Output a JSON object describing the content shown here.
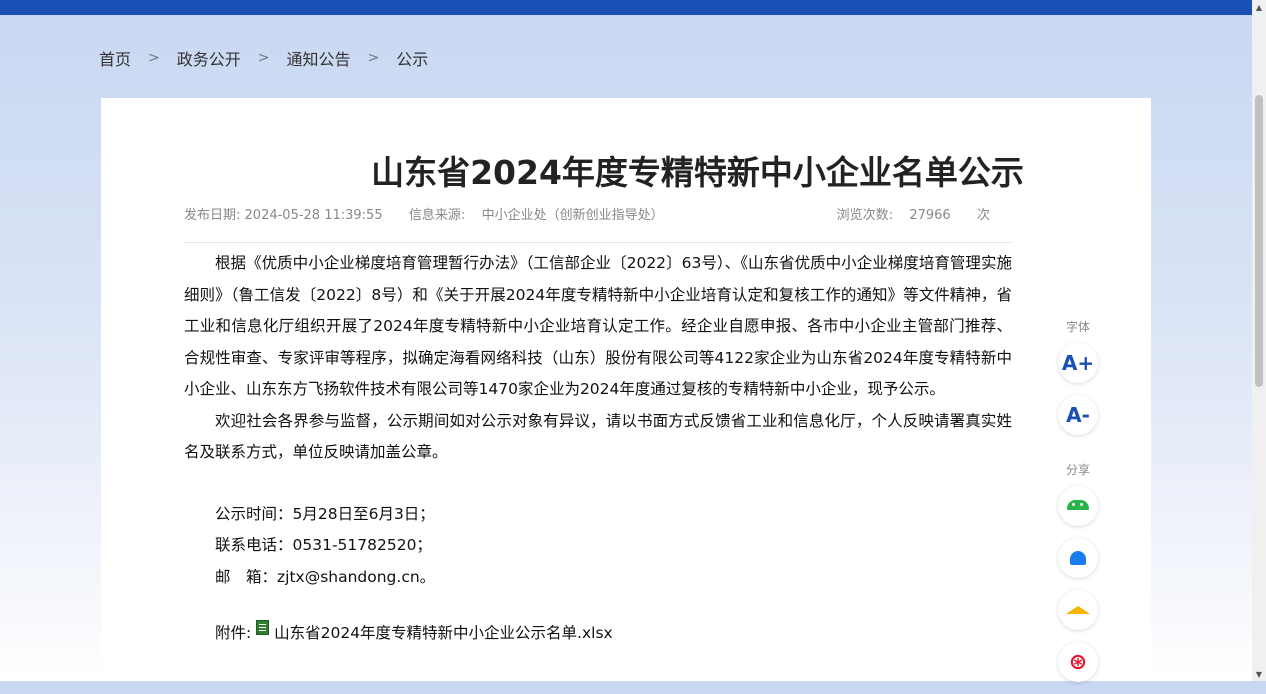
{
  "breadcrumb": {
    "items": [
      "首页",
      "政务公开",
      "通知公告",
      "公示"
    ],
    "separator": ">"
  },
  "article": {
    "title": "山东省2024年度专精特新中小企业名单公示",
    "meta": {
      "date_label": "发布日期:",
      "date": "2024-05-28 11:39:55",
      "source_label": "信息来源:",
      "source": "中小企业处（创新创业指导处）",
      "views_label": "浏览次数:",
      "views": "27966",
      "views_unit": "次"
    },
    "paragraphs": [
      "根据《优质中小企业梯度培育管理暂行办法》（工信部企业〔2022〕63号）、《山东省优质中小企业梯度培育管理实施细则》（鲁工信发〔2022〕8号）和《关于开展2024年度专精特新中小企业培育认定和复核工作的通知》等文件精神，省工业和信息化厅组织开展了2024年度专精特新中小企业培育认定工作。经企业自愿申报、各市中小企业主管部门推荐、合规性审查、专家评审等程序，拟确定海看网络科技（山东）股份有限公司等4122家企业为山东省2024年度专精特新中小企业、山东东方飞扬软件技术有限公司等1470家企业为2024年度通过复核的专精特新中小企业，现予公示。",
      "欢迎社会各界参与监督，公示期间如对公示对象有异议，请以书面方式反馈省工业和信息化厅，个人反映请署真实姓名及联系方式，单位反映请加盖公章。"
    ],
    "contact_lines": [
      "公示时间：5月28日至6月3日；",
      "联系电话：0531-51782520；",
      "邮　箱：zjtx@shandong.cn。"
    ],
    "attachment_label": "附件:",
    "attachment_file": "山东省2024年度专精特新中小企业公示名单.xlsx"
  },
  "sidetools": {
    "font_label": "字体",
    "font_increase": "A+",
    "font_decrease": "A-",
    "share_label": "分享",
    "share_items": [
      "wechat-icon",
      "qq-icon",
      "qzone-icon",
      "weibo-icon"
    ]
  }
}
